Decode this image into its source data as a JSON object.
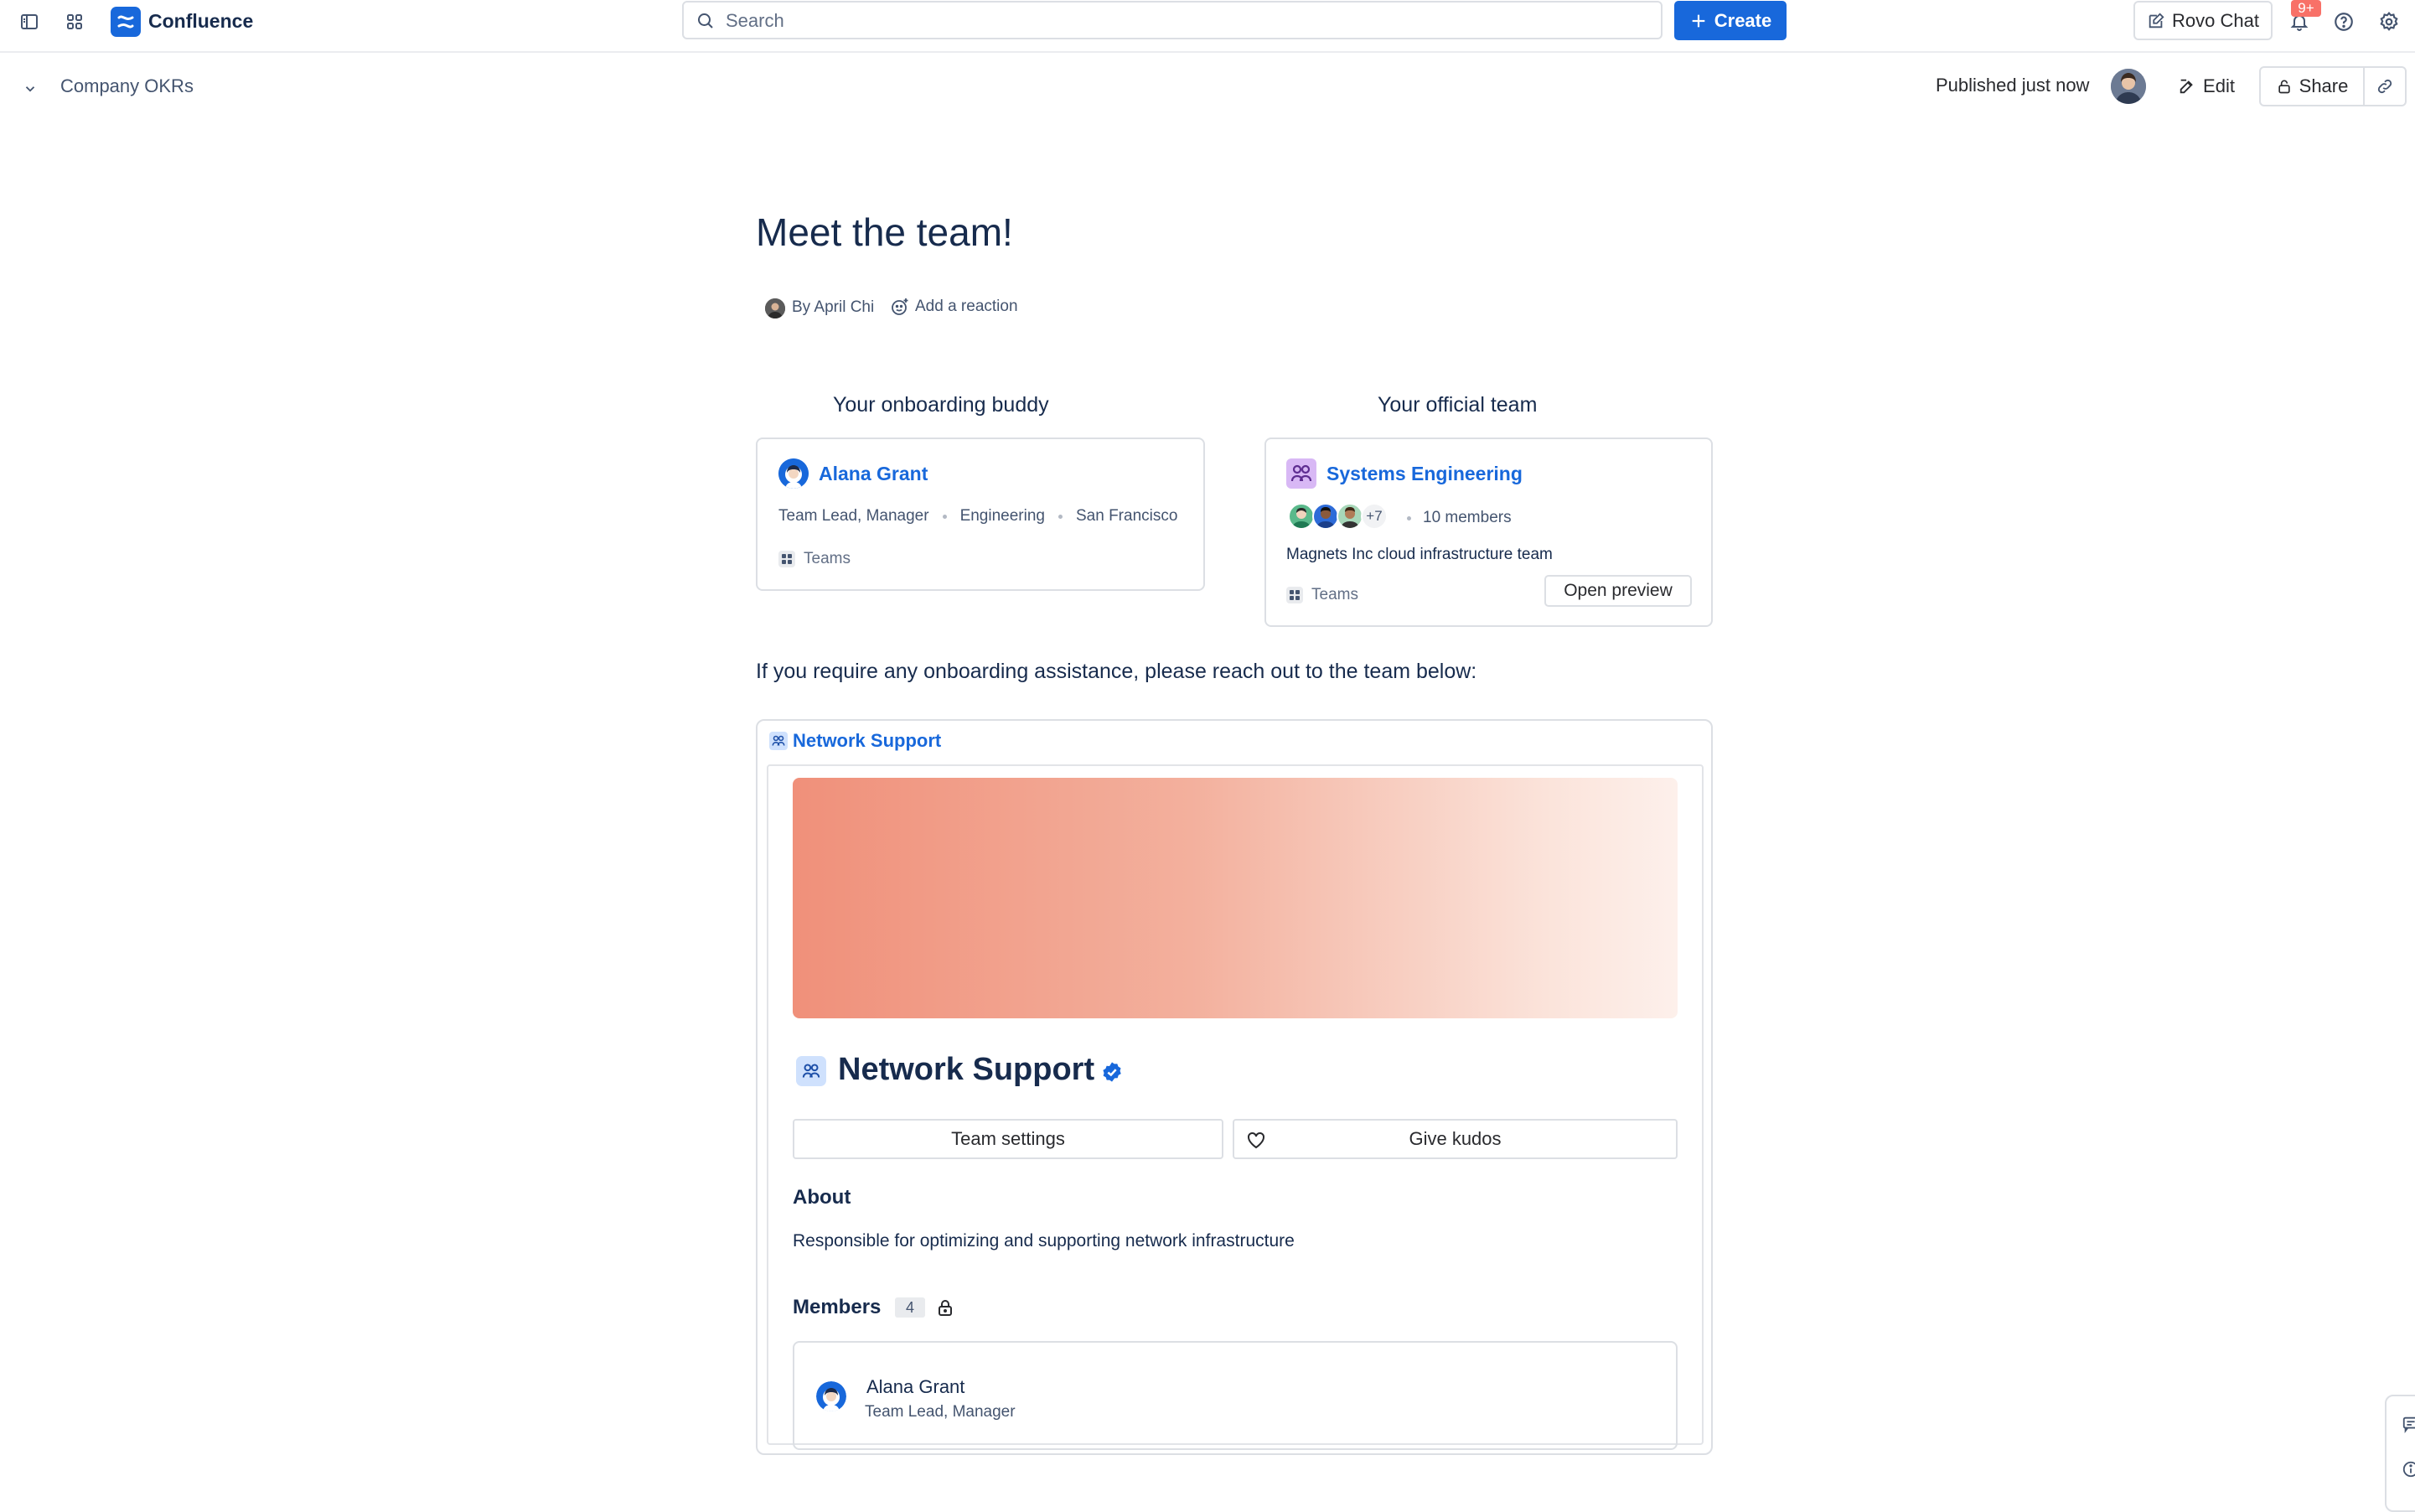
{
  "topbar": {
    "app_name": "Confluence",
    "search_placeholder": "Search",
    "create_label": "Create",
    "rovo_label": "Rovo Chat",
    "notifications_badge": "9+"
  },
  "page_header": {
    "breadcrumb": "Company OKRs",
    "published": "Published just now",
    "edit_label": "Edit",
    "share_label": "Share"
  },
  "content": {
    "title": "Meet the team!",
    "byline": "By April Chi",
    "reaction": "Add a reaction",
    "buddy": {
      "section": "Your onboarding buddy",
      "name": "Alana Grant",
      "role": "Team Lead, Manager",
      "dept": "Engineering",
      "location": "San Francisco",
      "source": "Teams"
    },
    "team": {
      "section": "Your official team",
      "name": "Systems Engineering",
      "extra_members": "+7",
      "members": "10 members",
      "description": "Magnets Inc cloud infrastructure team",
      "source": "Teams",
      "open_preview": "Open preview"
    },
    "assist_text": "If you require any onboarding assistance, please reach out to the team below:",
    "network": {
      "link": "Network Support",
      "title": "Network Support",
      "team_settings": "Team settings",
      "give_kudos": "Give kudos",
      "about_heading": "About",
      "about_text": "Responsible for optimizing and supporting network infrastructure",
      "members_heading": "Members",
      "members_count": "4",
      "member": {
        "name": "Alana Grant",
        "role": "Team Lead, Manager"
      }
    }
  },
  "colors": {
    "brand_blue": "#1868db",
    "banner_start": "#f0907a",
    "banner_end": "#fdf0eb",
    "badge_red": "#f87168"
  },
  "icons": [
    "sidebar-toggle-icon",
    "app-switcher-icon",
    "confluence-logo-icon",
    "search-icon",
    "plus-icon",
    "rovo-edit-icon",
    "bell-icon",
    "help-icon",
    "gear-icon",
    "chevron-down-icon",
    "pencil-icon",
    "lock-icon",
    "link-icon",
    "add-reaction-icon",
    "team-icon",
    "verified-icon",
    "heart-icon"
  ]
}
